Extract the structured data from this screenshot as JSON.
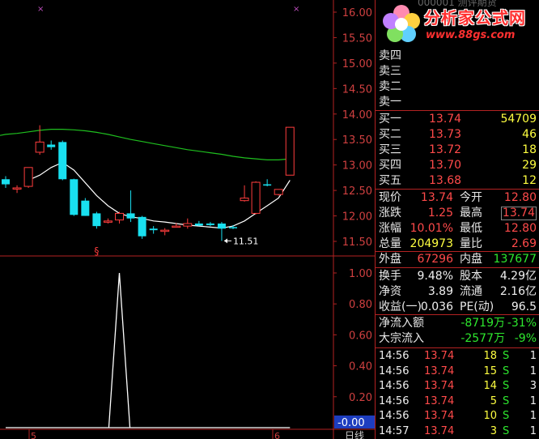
{
  "chart": {
    "price_axis": [
      "16.00",
      "15.50",
      "15.00",
      "14.50",
      "14.00",
      "13.50",
      "13.00",
      "12.50",
      "12.00",
      "11.50"
    ],
    "indicator_axis": [
      "1.00",
      "0.80",
      "0.60",
      "0.40",
      "0.20"
    ],
    "indicator_value": "-0.00",
    "low_marker": "11.51",
    "x_marks": [
      "5",
      "6"
    ],
    "signal_mark": "§",
    "bottom_label": "日线",
    "colors": {
      "up": "#ff3d3d",
      "down": "#19e0f0",
      "ma": "#1fbf1f",
      "ma_short": "#ffffff",
      "grid": "#b32222",
      "axis_text": "#d04040"
    },
    "candles": [
      {
        "o": 12.72,
        "h": 12.78,
        "l": 12.55,
        "c": 12.62
      },
      {
        "o": 12.55,
        "h": 12.6,
        "l": 12.45,
        "c": 12.55
      },
      {
        "o": 12.58,
        "h": 12.95,
        "l": 12.55,
        "c": 12.95
      },
      {
        "o": 13.25,
        "h": 13.78,
        "l": 13.2,
        "c": 13.45
      },
      {
        "o": 13.4,
        "h": 13.48,
        "l": 13.3,
        "c": 13.35
      },
      {
        "o": 13.45,
        "h": 13.48,
        "l": 12.7,
        "c": 12.72
      },
      {
        "o": 12.72,
        "h": 12.73,
        "l": 12.0,
        "c": 12.02
      },
      {
        "o": 12.3,
        "h": 12.35,
        "l": 12.0,
        "c": 12.0
      },
      {
        "o": 12.05,
        "h": 12.08,
        "l": 11.75,
        "c": 11.8
      },
      {
        "o": 11.9,
        "h": 11.95,
        "l": 11.85,
        "c": 11.9
      },
      {
        "o": 11.92,
        "h": 12.08,
        "l": 11.85,
        "c": 12.05
      },
      {
        "o": 12.05,
        "h": 12.5,
        "l": 11.88,
        "c": 11.95
      },
      {
        "o": 11.98,
        "h": 12.0,
        "l": 11.55,
        "c": 11.6
      },
      {
        "o": 11.75,
        "h": 11.8,
        "l": 11.65,
        "c": 11.72
      },
      {
        "o": 11.72,
        "h": 11.76,
        "l": 11.62,
        "c": 11.72
      },
      {
        "o": 11.8,
        "h": 11.86,
        "l": 11.78,
        "c": 11.8
      },
      {
        "o": 11.8,
        "h": 11.95,
        "l": 11.75,
        "c": 11.85
      },
      {
        "o": 11.85,
        "h": 11.9,
        "l": 11.8,
        "c": 11.81
      },
      {
        "o": 11.85,
        "h": 11.88,
        "l": 11.8,
        "c": 11.82
      },
      {
        "o": 11.85,
        "h": 11.88,
        "l": 11.51,
        "c": 11.75
      },
      {
        "o": 11.78,
        "h": 11.82,
        "l": 11.74,
        "c": 11.76
      },
      {
        "o": 12.3,
        "h": 12.6,
        "l": 12.28,
        "c": 12.35
      },
      {
        "o": 12.05,
        "h": 12.68,
        "l": 12.03,
        "c": 12.66
      },
      {
        "o": 12.62,
        "h": 12.72,
        "l": 12.58,
        "c": 12.6
      },
      {
        "o": 12.42,
        "h": 12.52,
        "l": 12.4,
        "c": 12.52
      },
      {
        "o": 12.8,
        "h": 13.74,
        "l": 12.8,
        "c": 13.74
      }
    ],
    "ma_long": [
      13.6,
      13.62,
      13.65,
      13.68,
      13.7,
      13.7,
      13.69,
      13.67,
      13.64,
      13.6,
      13.55,
      13.5,
      13.46,
      13.42,
      13.38,
      13.34,
      13.3,
      13.27,
      13.24,
      13.21,
      13.17,
      13.14,
      13.12,
      13.1,
      13.1,
      13.12
    ],
    "ma_short": [
      null,
      null,
      12.7,
      12.8,
      12.95,
      13.05,
      12.9,
      12.65,
      12.4,
      12.2,
      12.05,
      11.98,
      11.95,
      11.9,
      11.88,
      11.85,
      11.82,
      11.8,
      11.78,
      11.76,
      11.8,
      11.9,
      12.05,
      12.2,
      12.35,
      12.7
    ],
    "indicator": [
      0,
      0,
      0,
      0,
      0,
      0,
      0,
      0,
      0,
      0,
      0,
      0,
      0,
      0,
      0,
      0,
      0,
      0,
      0,
      0,
      0,
      0,
      0,
      0,
      0,
      0
    ]
  },
  "panel": {
    "logo_text": "分析家公式网",
    "logo_url": "www.88gs.com",
    "logo_hidden": "000001 测评期货",
    "sells": [
      {
        "label": "卖四",
        "price": "",
        "vol": ""
      },
      {
        "label": "卖三",
        "price": "",
        "vol": ""
      },
      {
        "label": "卖二",
        "price": "",
        "vol": ""
      },
      {
        "label": "卖一",
        "price": "",
        "vol": ""
      }
    ],
    "buys": [
      {
        "label": "买一",
        "price": "13.74",
        "vol": "54709"
      },
      {
        "label": "买二",
        "price": "13.73",
        "vol": "46"
      },
      {
        "label": "买三",
        "price": "13.72",
        "vol": "18"
      },
      {
        "label": "买四",
        "price": "13.70",
        "vol": "29"
      },
      {
        "label": "买五",
        "price": "13.68",
        "vol": "12"
      }
    ],
    "quote": [
      {
        "l1": "现价",
        "v1": "13.74",
        "l2": "今开",
        "v2": "12.80"
      },
      {
        "l1": "涨跌",
        "v1": "1.25",
        "l2": "最高",
        "v2": "13.74"
      },
      {
        "l1": "涨幅",
        "v1": "10.01%",
        "l2": "最低",
        "v2": "12.80"
      },
      {
        "l1": "总量",
        "v1": "204973",
        "l2": "量比",
        "v2": "2.69"
      }
    ],
    "outer": {
      "l1": "外盘",
      "v1": "67296",
      "l2": "内盘",
      "v2": "137677"
    },
    "stats": [
      {
        "l1": "换手",
        "v1": "9.48%",
        "l2": "股本",
        "v2": "4.29亿"
      },
      {
        "l1": "净资",
        "v1": "3.89",
        "l2": "流通",
        "v2": "2.16亿"
      },
      {
        "l1": "收益(一)",
        "v1": "0.036",
        "l2": "PE(动)",
        "v2": "96.5"
      }
    ],
    "flow": [
      {
        "label": "净流入额",
        "value": "-8719万",
        "pct": "-31%"
      },
      {
        "label": "大宗流入",
        "value": "-2577万",
        "pct": "-9%"
      }
    ],
    "ticks": [
      {
        "time": "14:56",
        "price": "13.74",
        "vol": "18",
        "side": "S",
        "n": "1"
      },
      {
        "time": "14:56",
        "price": "13.74",
        "vol": "15",
        "side": "S",
        "n": "1"
      },
      {
        "time": "14:56",
        "price": "13.74",
        "vol": "14",
        "side": "S",
        "n": "3"
      },
      {
        "time": "14:56",
        "price": "13.74",
        "vol": "5",
        "side": "S",
        "n": "1"
      },
      {
        "time": "14:56",
        "price": "13.74",
        "vol": "10",
        "side": "S",
        "n": "1"
      },
      {
        "time": "14:57",
        "price": "13.74",
        "vol": "3",
        "side": "S",
        "n": "1"
      }
    ]
  }
}
